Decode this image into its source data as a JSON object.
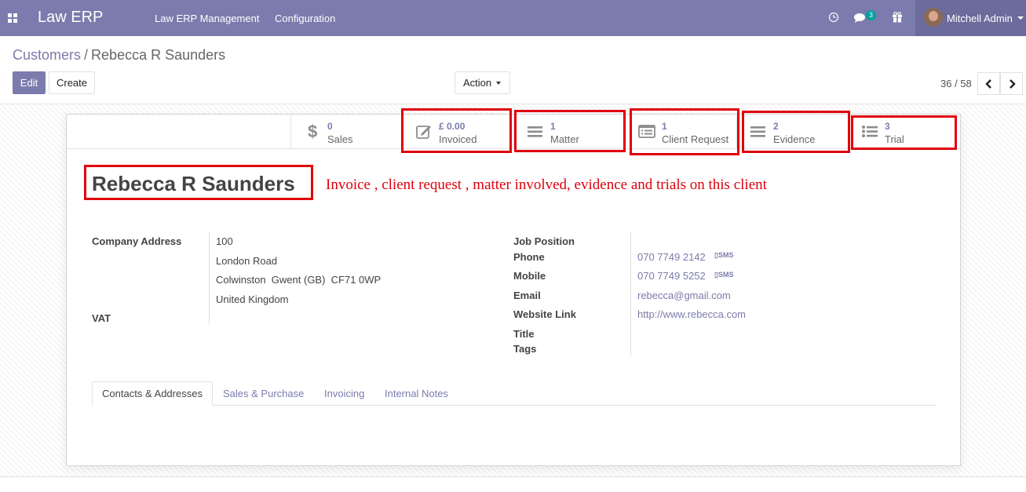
{
  "navbar": {
    "brand": "Law ERP",
    "menu": [
      "Law ERP Management",
      "Configuration"
    ],
    "messages_badge": "3",
    "user_name": "Mitchell Admin",
    "icons": [
      "apps-icon",
      "clock-icon",
      "chat-icon",
      "gift-icon",
      "caret-down-icon"
    ]
  },
  "breadcrumb": {
    "parent": "Customers",
    "separator": "/",
    "current": "Rebecca R Saunders"
  },
  "toolbar": {
    "edit_label": "Edit",
    "create_label": "Create",
    "action_label": "Action"
  },
  "pager": {
    "value": "36 / 58"
  },
  "stat_buttons": [
    {
      "value": "0",
      "label": "Sales",
      "icon": "dollar-icon"
    },
    {
      "value": "£ 0.00",
      "label": "Invoiced",
      "icon": "pencil-square-icon"
    },
    {
      "value": "1",
      "label": "Matter",
      "icon": "bars-icon"
    },
    {
      "value": "1",
      "label": "Client Request",
      "icon": "list-alt-icon"
    },
    {
      "value": "2",
      "label": "Evidence",
      "icon": "bars-icon"
    },
    {
      "value": "3",
      "label": "Trial",
      "icon": "list-icon"
    }
  ],
  "record": {
    "name": "Rebecca R Saunders"
  },
  "annotation": "Invoice , client request , matter involved, evidence and trials on this client",
  "left_fields": {
    "company_address_label": "Company Address",
    "address_lines": [
      "100",
      "London Road",
      "Colwinston  Gwent (GB)  CF71 0WP",
      "United Kingdom"
    ],
    "vat_label": "VAT"
  },
  "right_fields": {
    "job_position_label": "Job Position",
    "phone_label": "Phone",
    "phone_value": "070 7749 2142",
    "mobile_label": "Mobile",
    "mobile_value": "070 7749 5252",
    "sms_label": "SMS",
    "email_label": "Email",
    "email_value": "rebecca@gmail.com",
    "website_label": "Website Link",
    "website_value": "http://www.rebecca.com",
    "title_label": "Title",
    "tags_label": "Tags"
  },
  "tabs": [
    "Contacts & Addresses",
    "Sales & Purchase",
    "Invoicing",
    "Internal Notes"
  ],
  "colors": {
    "navbar": "#7c7bad",
    "accent": "#7c7bad",
    "highlight": "#e0000b",
    "badge": "#00a09d"
  }
}
